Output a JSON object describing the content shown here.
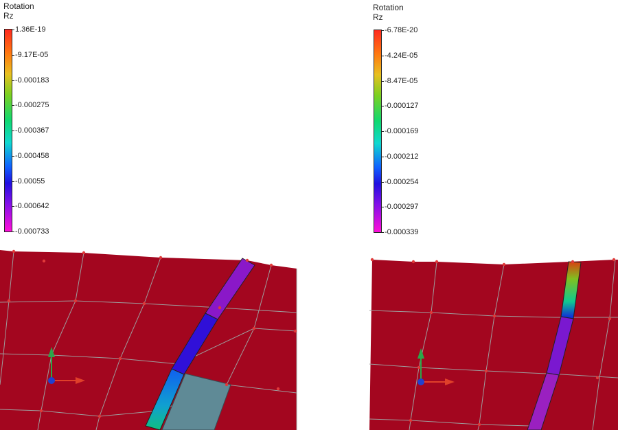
{
  "viewports": [
    {
      "legend": {
        "title_line1": "Rotation",
        "title_line2": "Rz",
        "ticks": [
          "1.36E-19",
          "-9.17E-05",
          "-0.000183",
          "-0.000275",
          "-0.000367",
          "-0.000458",
          "-0.00055",
          "-0.000642",
          "-0.000733"
        ]
      }
    },
    {
      "legend": {
        "title_line1": "Rotation",
        "title_line2": "Rz",
        "ticks": [
          "-6.78E-20",
          "-4.24E-05",
          "-8.47E-05",
          "-0.000127",
          "-0.000169",
          "-0.000212",
          "-0.000254",
          "-0.000297",
          "-0.000339"
        ]
      }
    }
  ],
  "colors": {
    "mesh_fill": "#a3061f",
    "mesh_lines": "#9e9e9e",
    "node": "#e03a3a",
    "selected_element": "#5f8a96",
    "axis_x": "#e0402a",
    "axis_y": "#2aa84a",
    "axis_z": "#2040d0"
  }
}
